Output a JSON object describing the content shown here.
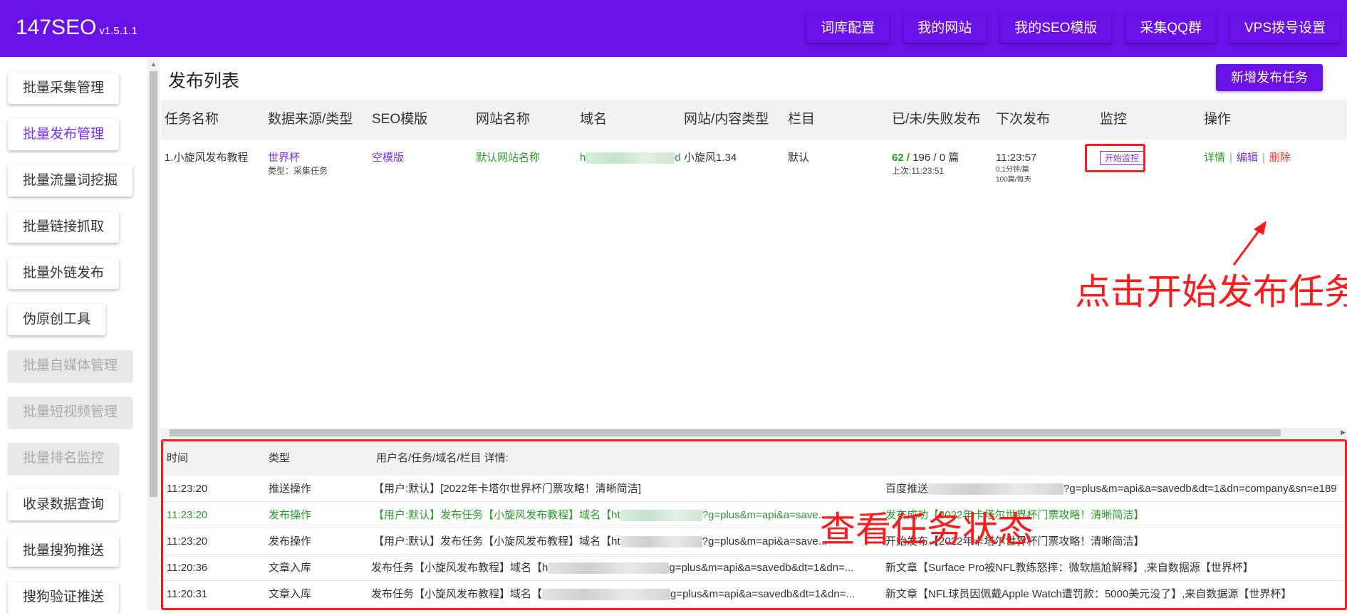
{
  "app": {
    "name": "147SEO",
    "version": "v1.5.1.1"
  },
  "topnav": [
    "词库配置",
    "我的网站",
    "我的SEO模版",
    "采集QQ群",
    "VPS拨号设置"
  ],
  "sidebar": [
    {
      "label": "批量采集管理",
      "state": "normal"
    },
    {
      "label": "批量发布管理",
      "state": "active"
    },
    {
      "label": "批量流量词挖掘",
      "state": "normal"
    },
    {
      "label": "批量链接抓取",
      "state": "normal"
    },
    {
      "label": "批量外链发布",
      "state": "normal"
    },
    {
      "label": "伪原创工具",
      "state": "normal"
    },
    {
      "label": "批量自媒体管理",
      "state": "disabled"
    },
    {
      "label": "批量短视频管理",
      "state": "disabled"
    },
    {
      "label": "批量排名监控",
      "state": "disabled"
    },
    {
      "label": "收录数据查询",
      "state": "normal"
    },
    {
      "label": "批量搜狗推送",
      "state": "normal"
    },
    {
      "label": "搜狗验证推送",
      "state": "normal"
    }
  ],
  "main": {
    "title": "发布列表",
    "new_task_label": "新增发布任务",
    "columns": [
      "任务名称",
      "数据来源/类型",
      "SEO模版",
      "网站名称",
      "域名",
      "网站/内容类型",
      "栏目",
      "已/未/失败发布",
      "下次发布",
      "监控",
      "操作"
    ],
    "task": {
      "name": "1.小旋风发布教程",
      "source": "世界杯",
      "source_type": "类型：采集任务",
      "template": "空模版",
      "site_name": "默认网站名称",
      "domain_start": "h",
      "domain_end": "d",
      "content_type": "小旋风1.34",
      "column": "默认",
      "published": "62 /",
      "counts_rest": "196 / 0 篇",
      "last_time": "上次:11:23:51",
      "next_time": "11:23:57",
      "interval": "0.1分钟/篇",
      "per_day": "100篇/每天",
      "monitor_label": "开始监控",
      "op_detail": "详情",
      "op_edit": "编辑",
      "op_delete": "删除",
      "op_sep": "|"
    }
  },
  "log": {
    "columns": [
      "时间",
      "类型",
      "用户名/任务/域名/栏目 详情:"
    ],
    "rows": [
      {
        "time": "11:23:20",
        "type": "推送操作",
        "detail": "【用户:默认】[2022年卡塔尔世界杯门票攻略！清晰简洁]",
        "result": "百度推送",
        "result_tail": "?g=plus&m=api&a=savedb&dt=1&dn=company&sn=e189",
        "status": "normal"
      },
      {
        "time": "11:23:20",
        "type": "发布操作",
        "detail": "【用户:默认】发布任务【小旋风发布教程】域名【ht",
        "detail_tail": "?g=plus&m=api&a=save...",
        "result": "发布成功【2022年卡塔尔世界杯门票攻略！清晰简洁】",
        "status": "ok"
      },
      {
        "time": "11:23:20",
        "type": "发布操作",
        "detail": "【用户:默认】发布任务【小旋风发布教程】域名【ht",
        "detail_tail": "?g=plus&m=api&a=save...",
        "result": "开始发布【2022年卡塔尔世界杯门票攻略！清晰简洁】",
        "status": "normal"
      },
      {
        "time": "11:20:36",
        "type": "文章入库",
        "detail": "发布任务【小旋风发布教程】域名【h",
        "detail_tail": "g=plus&m=api&a=savedb&dt=1&dn=...",
        "result": "新文章【Surface Pro被NFL教练怒摔：微软尴尬解释】,来自数据源【世界杯】",
        "status": "normal"
      },
      {
        "time": "11:20:31",
        "type": "文章入库",
        "detail": "发布任务【小旋风发布教程】域名【",
        "detail_tail": "g=plus&m=api&a=savedb&dt=1&dn=...",
        "result": "新文章【NFL球员因佩戴Apple Watch遭罚款：5000美元没了】,来自数据源【世界杯】",
        "status": "normal"
      }
    ]
  },
  "annotations": {
    "start_task": "点击开始发布任务",
    "view_status": "查看任务状态"
  },
  "colors": {
    "brand": "#6a11e8",
    "accent": "#7b2ff2",
    "success": "#2a9d2a",
    "danger": "#e53935",
    "annotation": "#ff1a1a"
  }
}
